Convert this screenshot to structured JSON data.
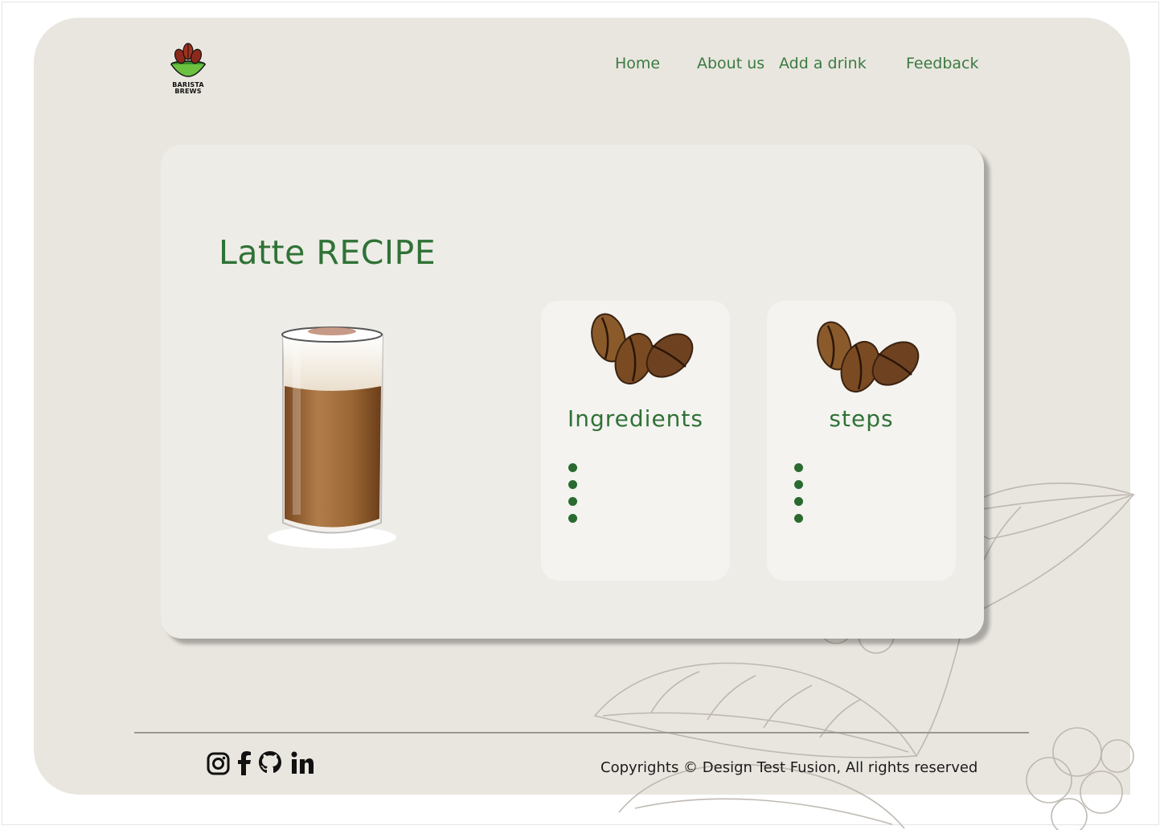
{
  "brand": {
    "logo_text_line1": "BARISTA",
    "logo_text_line2": "BREWS"
  },
  "nav": {
    "items": [
      {
        "label": "Home"
      },
      {
        "label": "About us"
      },
      {
        "label": "Add a drink"
      },
      {
        "label": "Feedback"
      }
    ]
  },
  "recipe": {
    "title": "Latte RECIPE",
    "panels": [
      {
        "title": "Ingredients",
        "bullets": 4
      },
      {
        "title": "steps",
        "bullets": 4
      }
    ]
  },
  "footer": {
    "social_icons": [
      "instagram-icon",
      "facebook-icon",
      "github-icon",
      "linkedin-icon"
    ],
    "copyright": "Copyrights © Design Test Fusion, All rights reserved"
  },
  "colors": {
    "accent_green": "#3b7a41",
    "page_background": "#e9e6df",
    "card_background": "#eeece7"
  }
}
